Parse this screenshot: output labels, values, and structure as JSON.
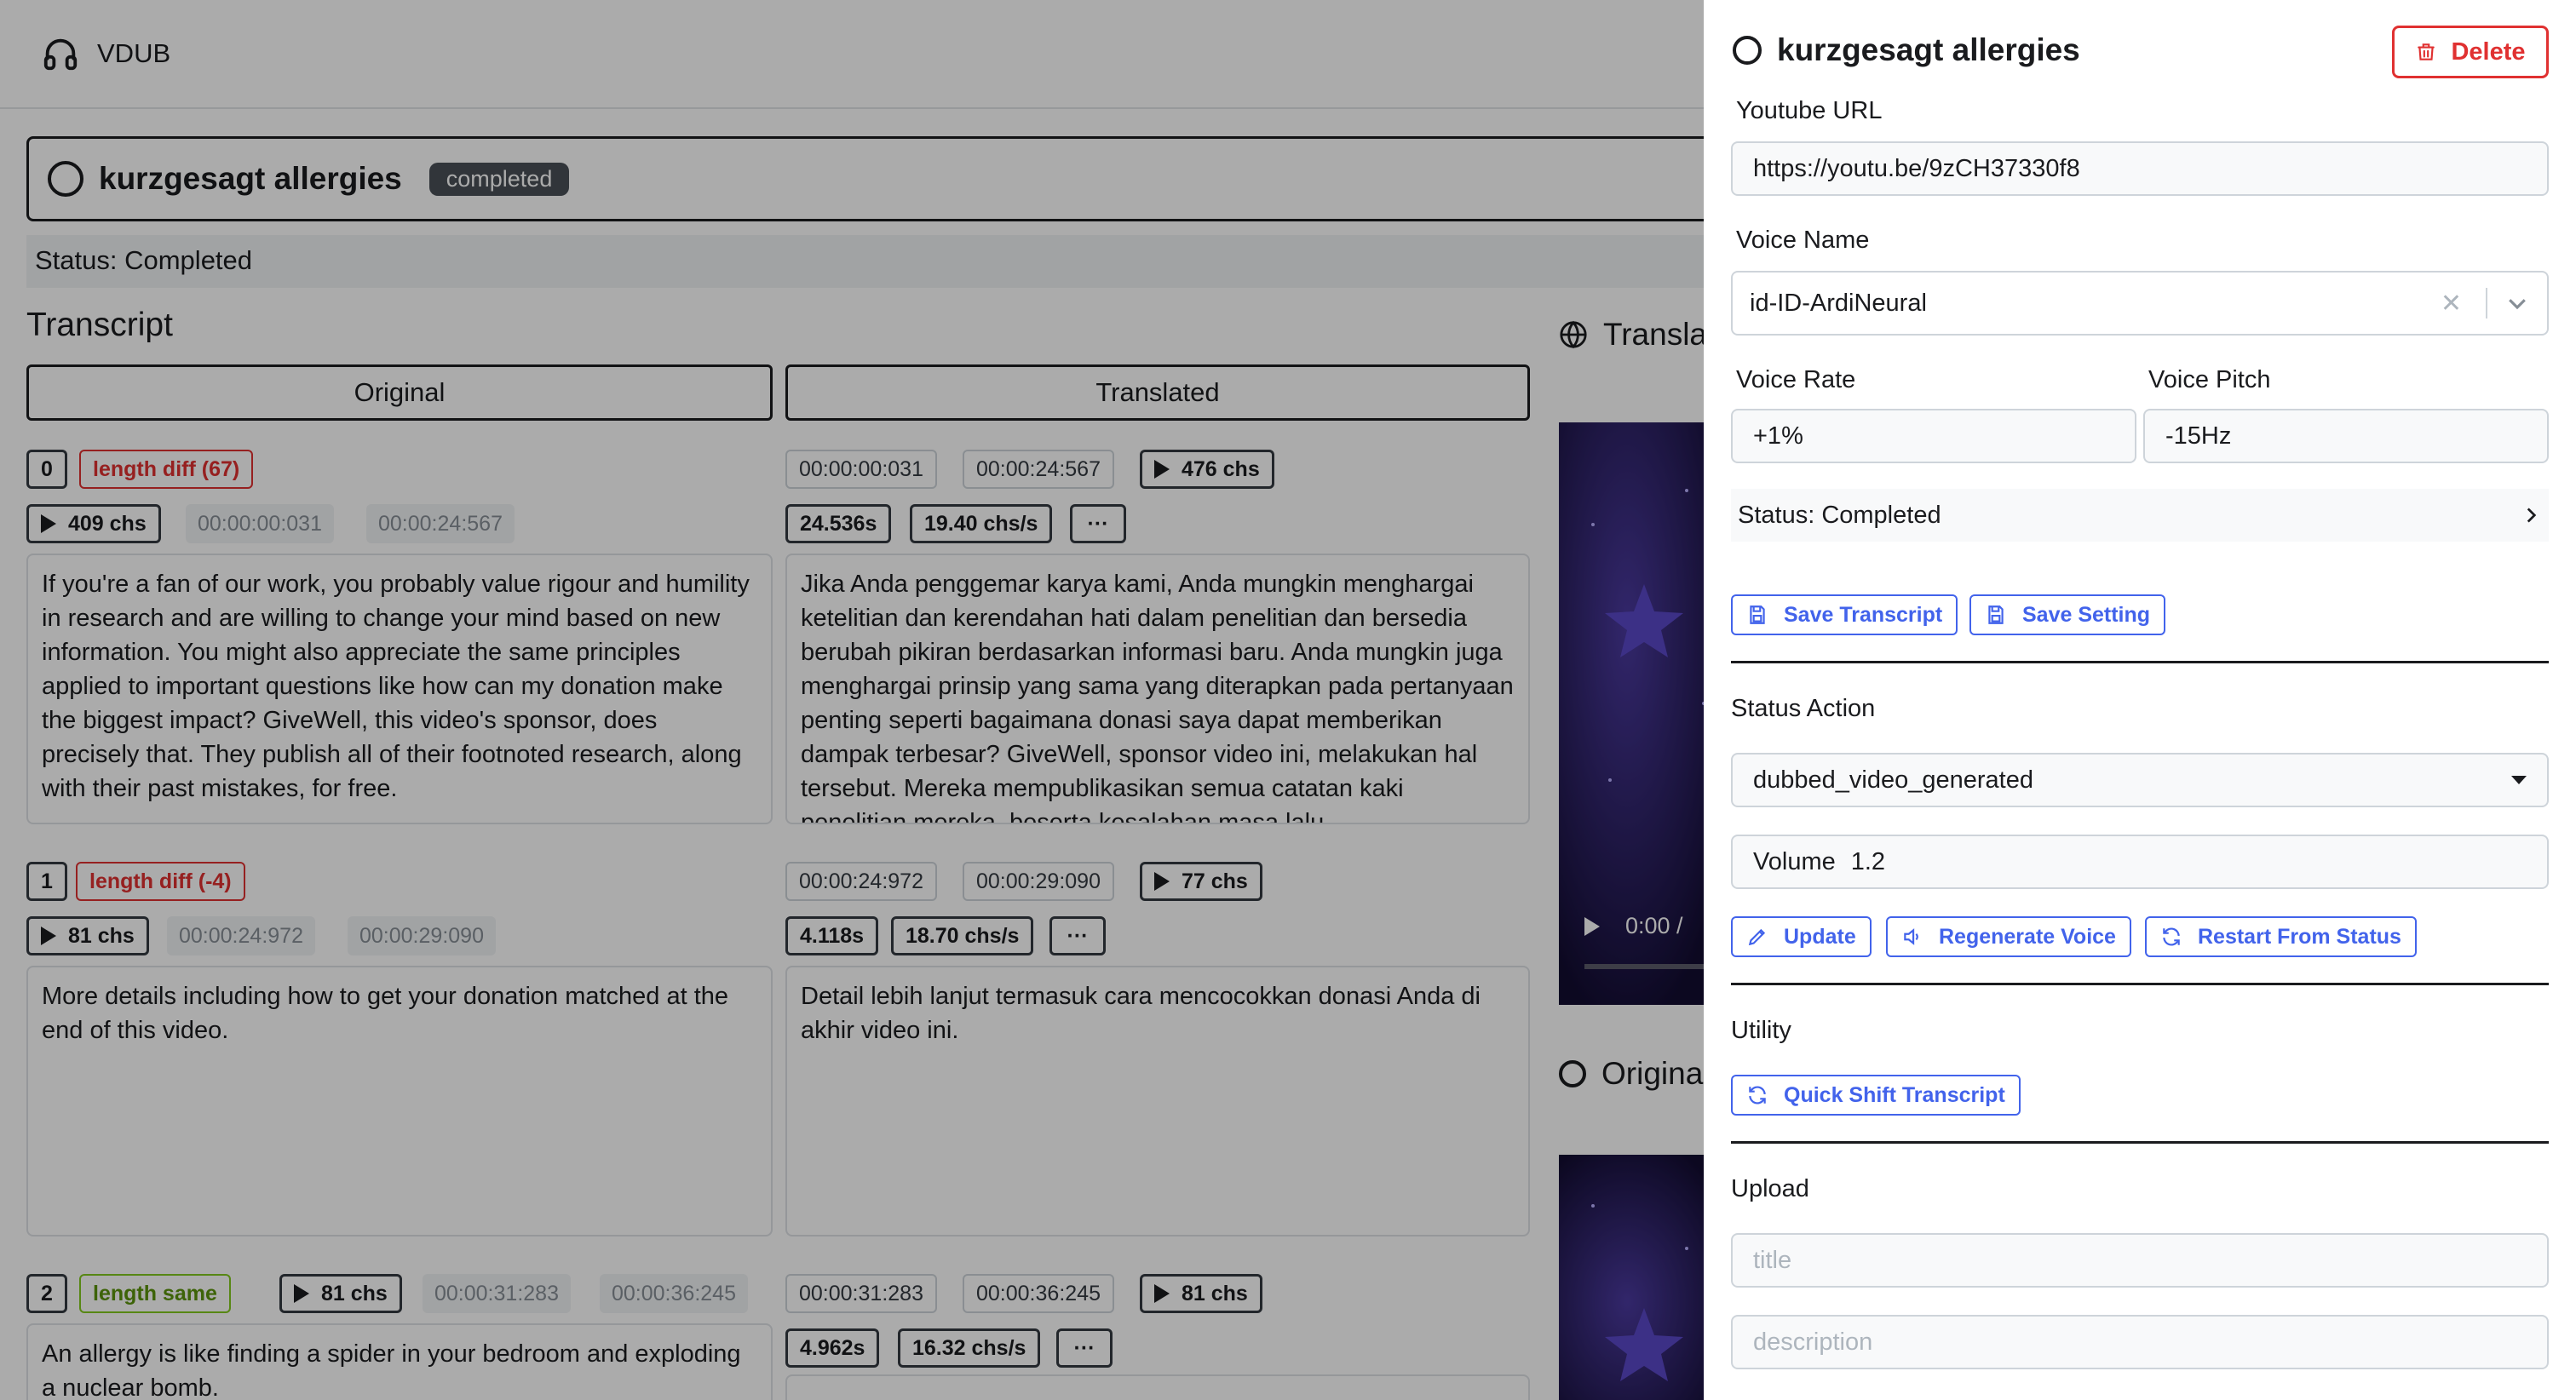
{
  "topbar": {
    "brand": "VDUB"
  },
  "job": {
    "title": "kurzgesagt allergies",
    "badge": "completed",
    "status": "Status: Completed"
  },
  "transcript": {
    "heading": "Transcript",
    "col_original": "Original",
    "col_translated": "Translated",
    "segments": [
      {
        "index": "0",
        "length_diff": "length diff (67)",
        "orig_chs": "409 chs",
        "orig_start": "00:00:00:031",
        "orig_end": "00:00:24:567",
        "tr_start": "00:00:00:031",
        "tr_end": "00:00:24:567",
        "tr_chs": "476 chs",
        "duration": "24.536s",
        "rate": "19.40 chs/s",
        "original_text": "If you're a fan of our work, you probably value rigour and humility in research and are willing to change your mind based on new information. You might also appreciate the same principles applied to important questions like how can my donation make the biggest impact? GiveWell, this video's sponsor, does precisely that. They publish all of their footnoted research, along with their past mistakes, for free.",
        "translated_text": "Jika Anda penggemar karya kami, Anda mungkin menghargai ketelitian dan kerendahan hati dalam penelitian dan bersedia berubah pikiran berdasarkan informasi baru. Anda mungkin juga menghargai prinsip yang sama yang diterapkan pada pertanyaan penting seperti bagaimana donasi saya dapat memberikan dampak terbesar? GiveWell, sponsor video ini, melakukan hal tersebut. Mereka mempublikasikan semua catatan kaki penelitian mereka, beserta kesalahan masa lalu"
      },
      {
        "index": "1",
        "length_diff": "length diff (-4)",
        "orig_chs": "81 chs",
        "orig_start": "00:00:24:972",
        "orig_end": "00:00:29:090",
        "tr_start": "00:00:24:972",
        "tr_end": "00:00:29:090",
        "tr_chs": "77 chs",
        "duration": "4.118s",
        "rate": "18.70 chs/s",
        "original_text": "More details including how to get your donation matched at the end of this video.",
        "translated_text": "Detail lebih lanjut termasuk cara mencocokkan donasi Anda di akhir video ini."
      },
      {
        "index": "2",
        "length_diff": "length same",
        "orig_chs": "81 chs",
        "orig_start": "00:00:31:283",
        "orig_end": "00:00:36:245",
        "tr_start": "00:00:31:283",
        "tr_end": "00:00:36:245",
        "tr_chs": "81 chs",
        "duration": "4.962s",
        "rate": "16.32 chs/s",
        "original_text": "An allergy is like finding a spider in your bedroom and exploding a nuclear bomb.",
        "translated_text": ""
      }
    ],
    "more_label": "···"
  },
  "right_column": {
    "translated_title": "Transla",
    "original_title": "Origina",
    "player_time": "0:00 /"
  },
  "drawer": {
    "title": "kurzgesagt allergies",
    "delete_label": "Delete",
    "youtube_label": "Youtube URL",
    "youtube_value": "https://youtu.be/9zCH37330f8",
    "voice_name_label": "Voice Name",
    "voice_name_value": "id-ID-ArdiNeural",
    "voice_rate_label": "Voice Rate",
    "voice_rate_value": "+1%",
    "voice_pitch_label": "Voice Pitch",
    "voice_pitch_value": "-15Hz",
    "status_row": "Status: Completed",
    "save_transcript": "Save Transcript",
    "save_setting": "Save Setting",
    "status_action_label": "Status Action",
    "status_action_value": "dubbed_video_generated",
    "volume_label": "Volume",
    "volume_value": "1.2",
    "update": "Update",
    "regenerate_voice": "Regenerate Voice",
    "restart_from_status": "Restart From Status",
    "utility_label": "Utility",
    "quick_shift": "Quick Shift Transcript",
    "upload_label": "Upload",
    "title_placeholder": "title",
    "description_placeholder": "description"
  },
  "colors": {
    "accent": "#4263eb",
    "danger": "#e03131",
    "success": "#5c940d",
    "badge": "#495057"
  }
}
